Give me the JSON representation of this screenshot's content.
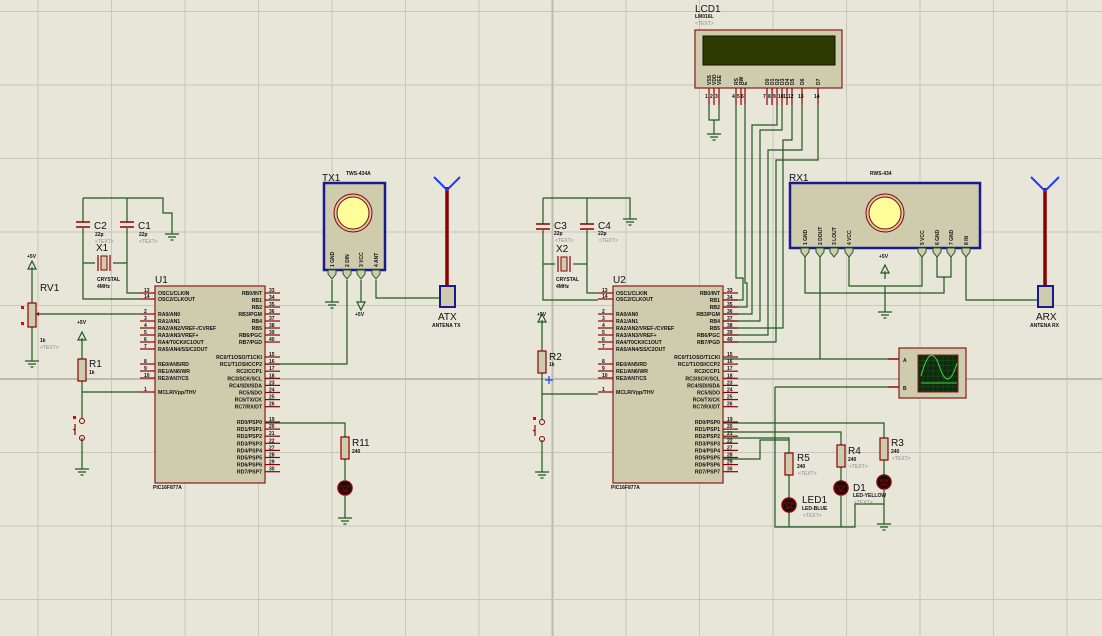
{
  "colors": {
    "background": "#e8e5d9",
    "wire": "#1e5a1e",
    "pin": "#8b0000",
    "body": "#cfccae",
    "module_border": "#1a1a8c",
    "lcd_screen": "#2f3b00",
    "scope_screen": "#0d2a0d"
  },
  "power_label": "+5V",
  "text_placeholder": "<TEXT>",
  "mcu_part": "PIC16F877A",
  "mcu_pins": {
    "left": [
      {
        "num": "13",
        "name": "OSC1/CLKIN"
      },
      {
        "num": "14",
        "name": "OSC2/CLKOUT"
      },
      {
        "num": "2",
        "name": "RA0/AN0"
      },
      {
        "num": "3",
        "name": "RA1/AN1"
      },
      {
        "num": "4",
        "name": "RA2/AN2/VREF-/CVREF"
      },
      {
        "num": "5",
        "name": "RA3/AN3/VREF+"
      },
      {
        "num": "6",
        "name": "RA4/T0CKI/C1OUT"
      },
      {
        "num": "7",
        "name": "RA5/AN4/SS/C2OUT"
      },
      {
        "num": "8",
        "name": "RE0/AN5/RD"
      },
      {
        "num": "9",
        "name": "RE1/AN6/WR"
      },
      {
        "num": "10",
        "name": "RE2/AN7/CS"
      },
      {
        "num": "1",
        "name": "MCLR/Vpp/THV"
      }
    ],
    "right": [
      {
        "num": "33",
        "name": "RB0/INT"
      },
      {
        "num": "34",
        "name": "RB1"
      },
      {
        "num": "35",
        "name": "RB2"
      },
      {
        "num": "36",
        "name": "RB3/PGM"
      },
      {
        "num": "37",
        "name": "RB4"
      },
      {
        "num": "38",
        "name": "RB5"
      },
      {
        "num": "39",
        "name": "RB6/PGC"
      },
      {
        "num": "40",
        "name": "RB7/PGD"
      },
      {
        "num": "15",
        "name": "RC0/T1OSO/T1CKI"
      },
      {
        "num": "16",
        "name": "RC1/T1OSI/CCP2"
      },
      {
        "num": "17",
        "name": "RC2/CCP1"
      },
      {
        "num": "18",
        "name": "RC3/SCK/SCL"
      },
      {
        "num": "23",
        "name": "RC4/SDI/SDA"
      },
      {
        "num": "24",
        "name": "RC5/SDO"
      },
      {
        "num": "25",
        "name": "RC6/TX/CK"
      },
      {
        "num": "26",
        "name": "RC7/RX/DT"
      },
      {
        "num": "19",
        "name": "RD0/PSP0"
      },
      {
        "num": "20",
        "name": "RD1/PSP1"
      },
      {
        "num": "21",
        "name": "RD2/PSP2"
      },
      {
        "num": "22",
        "name": "RD3/PSP3"
      },
      {
        "num": "27",
        "name": "RD4/PSP4"
      },
      {
        "num": "28",
        "name": "RD5/PSP5"
      },
      {
        "num": "29",
        "name": "RD6/PSP6"
      },
      {
        "num": "30",
        "name": "RD7/PSP7"
      }
    ]
  },
  "u1": {
    "ref": "U1"
  },
  "u2": {
    "ref": "U2"
  },
  "c1": {
    "ref": "C1",
    "value": "22p"
  },
  "c2": {
    "ref": "C2",
    "value": "22p"
  },
  "c3": {
    "ref": "C3",
    "value": "22p"
  },
  "c4": {
    "ref": "C4",
    "value": "22p"
  },
  "x1": {
    "ref": "X1",
    "part": "CRYSTAL",
    "value": "4MHz"
  },
  "x2": {
    "ref": "X2",
    "part": "CRYSTAL",
    "value": "4MHz"
  },
  "rv1": {
    "ref": "RV1",
    "value": "1k"
  },
  "r1": {
    "ref": "R1",
    "value": "1k"
  },
  "r2": {
    "ref": "R2",
    "value": "1k"
  },
  "r11": {
    "ref": "R11",
    "value": "240"
  },
  "r3": {
    "ref": "R3",
    "value": "240"
  },
  "r4": {
    "ref": "R4",
    "value": "240"
  },
  "r5": {
    "ref": "R5",
    "value": "240"
  },
  "d1": {
    "ref": "D1",
    "part": "LED-YELLOW"
  },
  "led1": {
    "ref": "LED1",
    "part": "LED-BLUE"
  },
  "tx1": {
    "ref": "TX1",
    "part": "TWS-434A",
    "pins": [
      "1 GND",
      "2 DIN",
      "3 VCC",
      "4 ANT"
    ]
  },
  "rx1": {
    "ref": "RX1",
    "part": "RWS-434",
    "pins": [
      "1 GND",
      "2 DOUT",
      "3 LOUT",
      "4 VCC",
      "5 VCC",
      "6 GND",
      "7 GND",
      "8 IN"
    ]
  },
  "atx": {
    "ref": "ATX",
    "part": "ANTENA TX"
  },
  "arx": {
    "ref": "ARX",
    "part": "ANTENA RX"
  },
  "lcd1": {
    "ref": "LCD1",
    "part": "LM016L",
    "pins": [
      "VSS",
      "VDD",
      "VEE",
      "RS",
      "RW",
      "E",
      "D0",
      "D1",
      "D2",
      "D3",
      "D4",
      "D5",
      "D6",
      "D7"
    ]
  },
  "scope": {
    "ch_a": "A",
    "ch_b": "B"
  }
}
